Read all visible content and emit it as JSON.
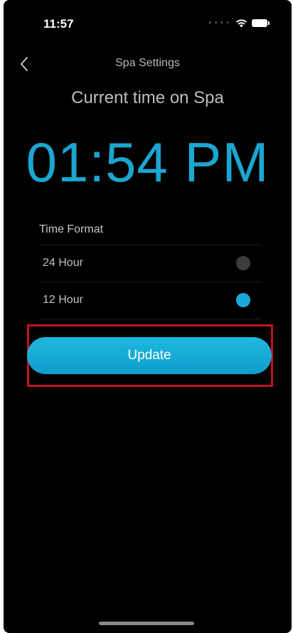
{
  "status_bar": {
    "time": "11:57",
    "signal_icon": "signal-dots-icon",
    "wifi_icon": "wifi-icon",
    "battery_icon": "battery-icon"
  },
  "nav": {
    "back_icon": "chevron-left-icon",
    "title": "Spa Settings"
  },
  "main": {
    "subtitle": "Current time on Spa",
    "current_time": "01:54 PM"
  },
  "time_format": {
    "label": "Time Format",
    "options": [
      {
        "label": "24 Hour",
        "selected": false
      },
      {
        "label": "12 Hour",
        "selected": true
      }
    ]
  },
  "actions": {
    "update_label": "Update"
  },
  "colors": {
    "background": "#000000",
    "accent": "#1ba6d0",
    "radio_off": "#3d3d3d",
    "highlight": "#c0141c"
  }
}
